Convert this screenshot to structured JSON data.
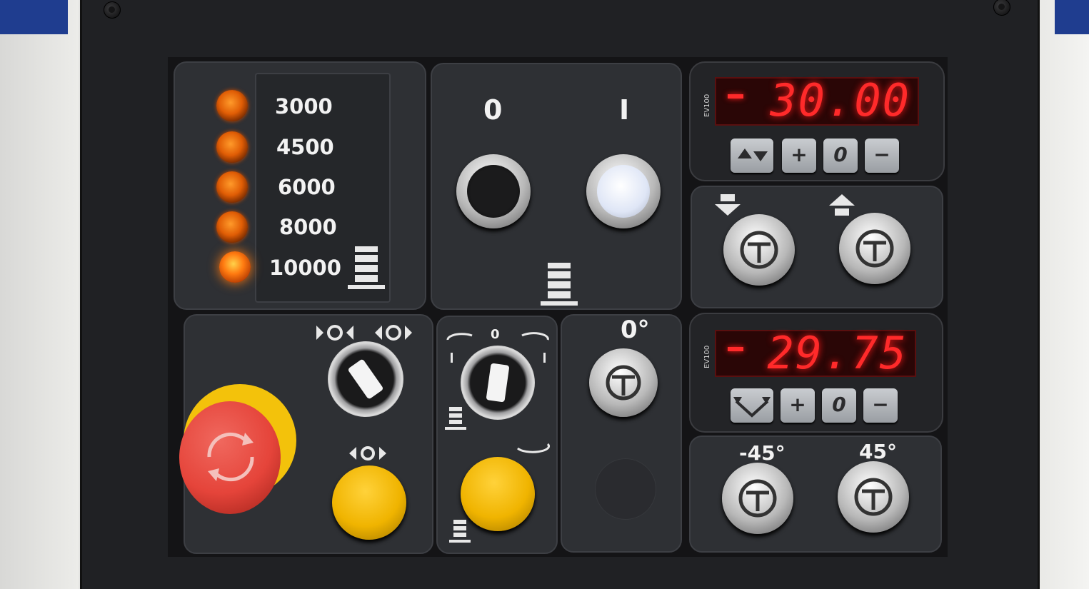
{
  "speed_selector": {
    "values": [
      "3000",
      "4500",
      "6000",
      "8000",
      "10000"
    ],
    "active": "10000"
  },
  "switch": {
    "off_label": "0",
    "on_label": "I"
  },
  "display_top": {
    "value": "30.00",
    "sign": "-",
    "model": "EV100"
  },
  "display_bottom": {
    "value": "29.75",
    "sign": "-",
    "model": "EV100"
  },
  "keypad": {
    "plus": "+",
    "zero": "0",
    "minus": "−"
  },
  "angle": {
    "zero": "0°",
    "minus45": "-45°",
    "plus45": "45°"
  },
  "rotation_selector": {
    "center": "0"
  },
  "colors": {
    "lcd_red": "#ff2a2a",
    "led_orange": "#ff7a10",
    "estop_red": "#e5443a",
    "estop_yellow": "#f3c20b",
    "button_yellow": "#f0b400"
  }
}
